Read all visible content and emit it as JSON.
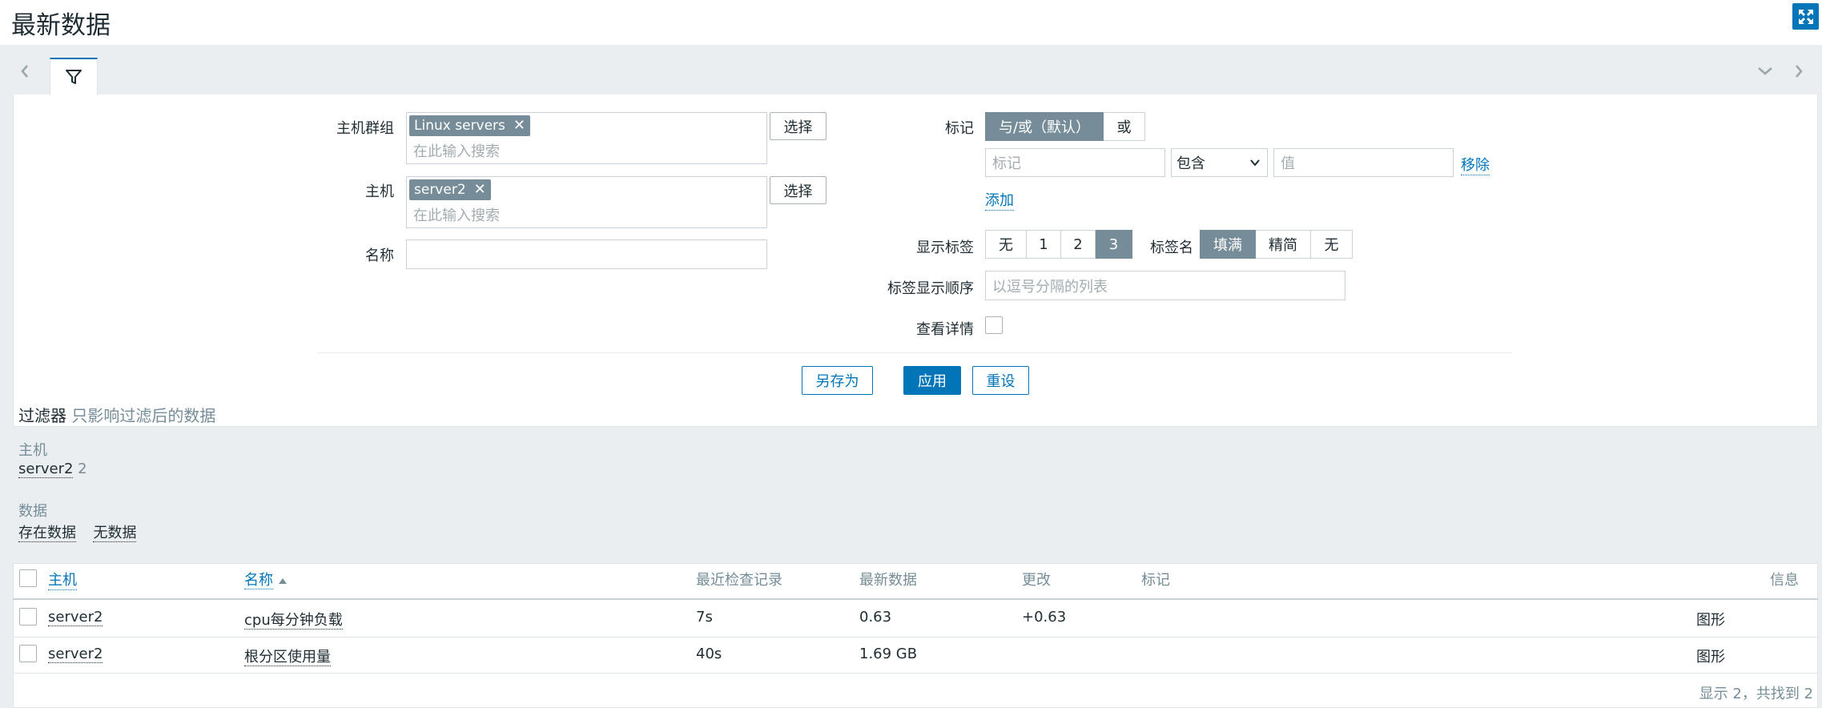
{
  "header": {
    "title": "最新数据"
  },
  "filter": {
    "host_group_label": "主机群组",
    "host_group_chip": "Linux servers",
    "host_label": "主机",
    "host_chip": "server2",
    "search_placeholder": "在此输入搜索",
    "select_label": "选择",
    "name_label": "名称",
    "tags_label": "标记",
    "tag_ops": [
      "与/或（默认）",
      "或"
    ],
    "tag_placeholder": "标记",
    "tag_operator": "包含",
    "value_placeholder": "值",
    "remove_label": "移除",
    "add_label": "添加",
    "show_tags_label": "显示标签",
    "show_tags_options": [
      "无",
      "1",
      "2",
      "3"
    ],
    "tag_name_label": "标签名",
    "tag_name_options": [
      "填满",
      "精简",
      "无"
    ],
    "tag_priority_label": "标签显示顺序",
    "tag_priority_placeholder": "以逗号分隔的列表",
    "show_details_label": "查看详情",
    "save_as_label": "另存为",
    "apply_label": "应用",
    "reset_label": "重设"
  },
  "subfilter": {
    "title": "过滤器",
    "note": "只影响过滤后的数据",
    "hosts_title": "主机",
    "host_item": "server2",
    "host_count": "2",
    "data_title": "数据",
    "data_items": [
      "存在数据",
      "无数据"
    ]
  },
  "table": {
    "columns": [
      "主机",
      "名称",
      "最近检查记录",
      "最新数据",
      "更改",
      "标记",
      "信息"
    ],
    "rows": [
      {
        "host": "server2",
        "name": "cpu每分钟负载",
        "last_check": "7s",
        "last_value": "0.63",
        "change": "+0.63",
        "graph": "图形"
      },
      {
        "host": "server2",
        "name": "根分区使用量",
        "last_check": "40s",
        "last_value": "1.69 GB",
        "change": "",
        "graph": "图形"
      }
    ],
    "footer": "显示 2，共找到 2"
  },
  "colors": {
    "accent": "#0275b8",
    "chip": "#768d99",
    "background": "#ebeef0"
  }
}
